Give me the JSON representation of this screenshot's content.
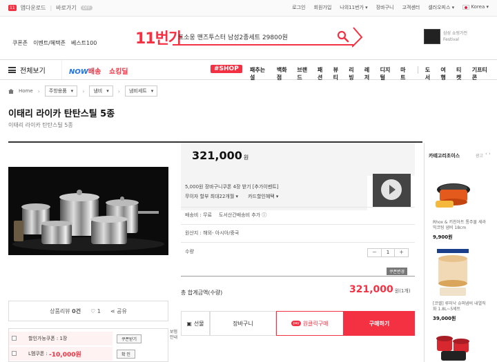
{
  "topbar": {
    "app_badge": "11",
    "app_download": "앱다운로드",
    "shortcut": "바로가기",
    "shortcut_badge": "OFF",
    "links": [
      "로그인",
      "회원가입",
      "나의11번가 ▾",
      "장바구니",
      "고객센터",
      "셀러오피스 ▾"
    ],
    "country": "Korea ▾"
  },
  "header": {
    "quick_links": [
      "쿠폰존",
      "이벤트/혜택존",
      "베스트100"
    ],
    "logo": "11번가",
    "search_query": "토소웅 맨즈투스터 남성2종세트 29800원",
    "ad_text": [
      "삼성 쇼핑가전",
      "Festival"
    ]
  },
  "nav": {
    "all_menu": "전체보기",
    "now_label": "NOW",
    "now_suffix": "배송",
    "shopping_talk": "쇼킹딜",
    "shop_tag": "#SHOP",
    "items_a": [
      "패추는 설",
      "백화점",
      "브랜드",
      "패션",
      "뷰티",
      "리빙",
      "레저",
      "디지털",
      "마트"
    ],
    "items_b": [
      "도서",
      "여행",
      "티켓",
      "기프티콘"
    ]
  },
  "breadcrumb": {
    "home": "Home",
    "levels": [
      "주방용품",
      "냄비",
      "냄비세트"
    ]
  },
  "product": {
    "title": "이태리 라이카 탄탄스틸 5종",
    "subtitle": "이태리 라이카 탄탄스틸 5종",
    "review": "상품리뷰",
    "review_count": "0건",
    "like_count": "1",
    "share": "공유",
    "coupon_rows": [
      {
        "label": "할인가능쿠폰 : 1장",
        "button": "쿠폰받기"
      },
      {
        "label": "L멤쿠폰 : ",
        "price": "-10,000원",
        "button": "확 인"
      }
    ],
    "side_note": "보험안내"
  },
  "purchase": {
    "price": "321,000",
    "price_unit": "원",
    "info1": "5,000원 장바구니쿠폰 4장 받기 [추가이벤트]",
    "info2a": "무이자 할부 최대22개월 ▾",
    "info2b": "카드할인혜택 ▾",
    "shipping_label": "배송비 : 무료",
    "shipping_more": "도서산간배송비 추가 ⓘ",
    "origin": "원산지 : 해외- 아시아/중국",
    "qty_label": "수량",
    "qty_minus": "－",
    "qty_value": "1",
    "qty_plus": "＋",
    "coupon_change": "쿠폰변경",
    "total_label": "총 합계금액(수량)",
    "total_price": "321,000",
    "total_unit": "원(1개)",
    "btn_gift": "선물",
    "btn_cart": "장바구니",
    "btn_pay_badge": "pay",
    "btn_oneclick": "원클릭구매",
    "btn_buy": "구매하기"
  },
  "sidebar": {
    "title": "카테고리초이스",
    "ad": "광고",
    "arrows": "‹ ›",
    "items": [
      {
        "text": "Rhox & 키친아트 통주물 세라믹코팅 냄비 18cm",
        "price": "9,900원"
      },
      {
        "text": "[코렐] 루미낙 슈퍼냄비 내열직화 1.8L~5세트",
        "price": "39,000원"
      }
    ]
  },
  "colors": {
    "brand": "#f43142",
    "now_blue": "#1e73e8"
  }
}
